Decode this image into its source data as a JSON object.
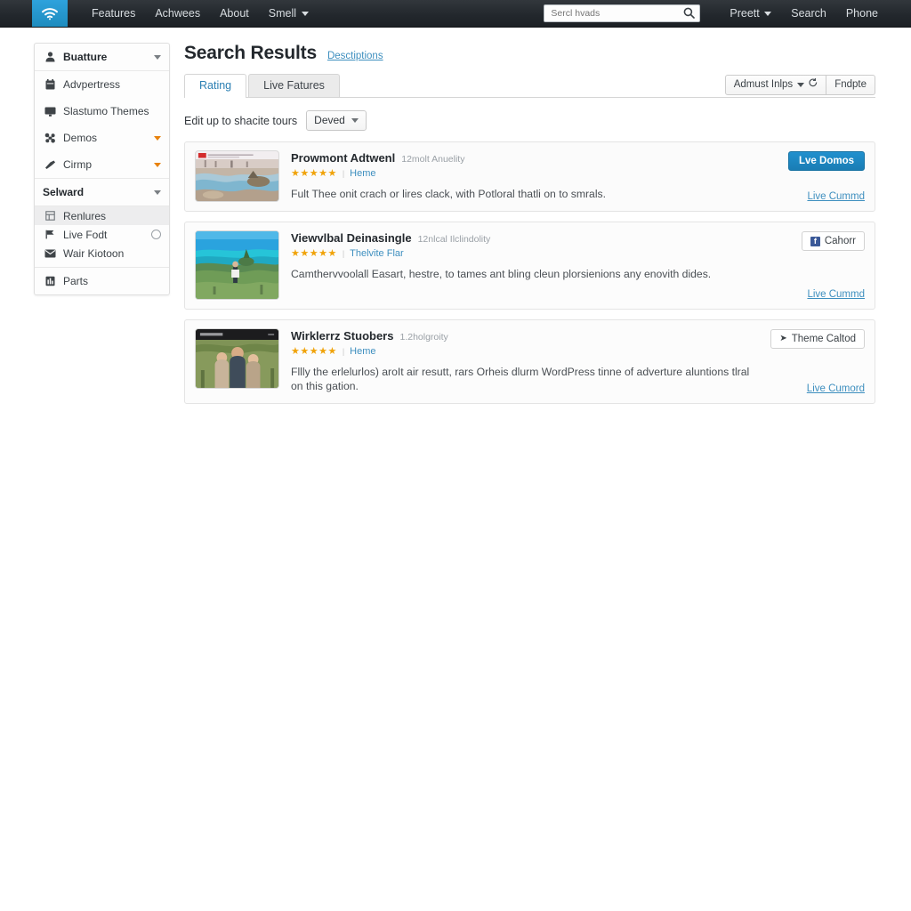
{
  "topnav": {
    "logo_icon": "wifi-icon",
    "links": [
      "Features",
      "Achwees",
      "About",
      "Smell"
    ],
    "search": {
      "placeholder": "Sercl hvads",
      "value": "",
      "icon": "search-icon"
    },
    "right_links": [
      "Preett",
      "Search",
      "Phone"
    ]
  },
  "sidebar": {
    "groups": [
      {
        "items": [
          {
            "label": "Buatture",
            "icon": "person-icon",
            "caret": "gray",
            "active": false,
            "head": true
          }
        ]
      },
      {
        "items": [
          {
            "label": "Advpertress",
            "icon": "calendar-icon",
            "caret": "none",
            "active": false,
            "head": false
          },
          {
            "label": "Slastumo Themes",
            "icon": "monitor-icon",
            "caret": "none",
            "active": false,
            "head": false
          },
          {
            "label": "Demos",
            "icon": "puzzle-icon",
            "caret": "orange",
            "active": false,
            "head": false
          },
          {
            "label": "Cirmp",
            "icon": "brush-icon",
            "caret": "orange",
            "active": false,
            "head": false
          }
        ]
      },
      {
        "items": [
          {
            "label": "Selward",
            "icon": "none",
            "caret": "gray",
            "active": false,
            "head": true
          }
        ]
      },
      {
        "dense": true,
        "items": [
          {
            "label": "Renlures",
            "icon": "grid-icon",
            "caret": "none",
            "active": true,
            "head": false
          },
          {
            "label": "Live Fodt",
            "icon": "flag-icon",
            "caret": "none",
            "badge": true,
            "active": false,
            "head": false
          },
          {
            "label": "Wair Kiotoon",
            "icon": "mail-icon",
            "caret": "none",
            "active": false,
            "head": false
          }
        ]
      },
      {
        "items": [
          {
            "label": "Parts",
            "icon": "chart-icon",
            "caret": "none",
            "active": false,
            "head": false
          }
        ]
      }
    ]
  },
  "main": {
    "title": "Search Results",
    "head_link": "Desctiptions",
    "tabs": [
      {
        "label": "Rating",
        "active": true
      },
      {
        "label": "Live Fatures",
        "active": false
      }
    ],
    "toolbar": {
      "adjust_label": "Admust Inlps",
      "adjust_icon": "refresh-icon",
      "update_label": "Fndpte"
    },
    "filter": {
      "text": "Edit up to shacite tours",
      "select_value": "Deved"
    },
    "results": [
      {
        "thumb": "landscape-red-header-thumbnail",
        "title": "Prowmont Adtwenl",
        "meta": "12molt Anuelity",
        "stars": "★★★★★",
        "rating_link": "Heme",
        "description": "Fult Thee onit crach or lires clack, with Potloral thatli on to smrals.",
        "action_label": "Lve Domos",
        "action_style": "primary",
        "action_icon": "none",
        "link_label": "Live Cummd"
      },
      {
        "thumb": "beach-coastline-thumbnail",
        "title": "Viewvlbal Deinasingle",
        "meta": "12nlcal Ilclindolity",
        "stars": "★★★★★",
        "rating_link": "Thelvite Flar",
        "description": "Camthervvoolall Easart, hestre, to tames ant bling cleun plorsienions any enovith dides.",
        "action_label": "Cahorr",
        "action_style": "outline",
        "action_icon": "facebook-icon",
        "link_label": "Live Cummd"
      },
      {
        "thumb": "group-people-dark-header-thumbnail",
        "title": "Wirklerrz Stuobers",
        "meta": "1.2holgroity",
        "stars": "★★★★★",
        "rating_link": "Heme",
        "description": "Fllly the erlelurlos) aroIt air resutt, rars Orheis dlurm WordPress tinne of adverture aluntions tlral on this gation.",
        "action_label": "Theme Caltod",
        "action_style": "outline",
        "action_icon": "rocket-icon",
        "link_label": "Live Cumord"
      }
    ]
  },
  "colors": {
    "accent_blue": "#1e8cbe",
    "link_blue": "#3e8fbf",
    "star_orange": "#f0a30a",
    "nav_dark": "#23282d",
    "caret_orange": "#e8820c"
  }
}
